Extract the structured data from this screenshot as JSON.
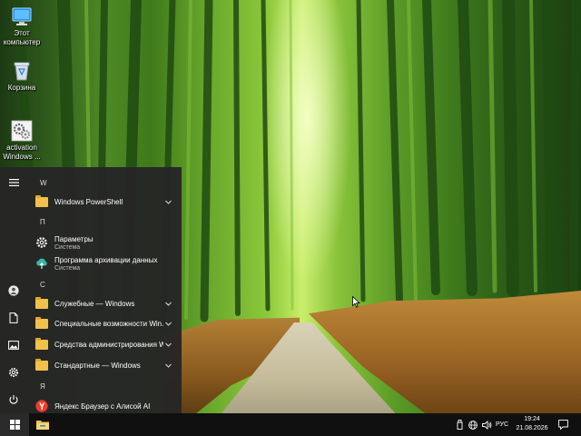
{
  "desktop": {
    "icons": [
      {
        "name": "this-pc",
        "label": "Этот компьютер",
        "icon": "monitor-icon"
      },
      {
        "name": "recycle-bin",
        "label": "Корзина",
        "icon": "recycle-bin-icon"
      },
      {
        "name": "activation-windows",
        "label": "activation Windows ...",
        "icon": "gears-icon"
      }
    ]
  },
  "start_menu": {
    "rail": [
      {
        "name": "hamburger-icon"
      },
      {
        "name": "user-avatar-icon"
      },
      {
        "name": "documents-icon"
      },
      {
        "name": "pictures-icon"
      },
      {
        "name": "settings-gear-icon"
      },
      {
        "name": "power-icon"
      }
    ],
    "groups": [
      {
        "letter": "W",
        "items": [
          {
            "label": "Windows PowerShell",
            "icon": "folder-icon",
            "expandable": true
          }
        ]
      },
      {
        "letter": "П",
        "items": [
          {
            "label": "Параметры",
            "sub": "Система",
            "icon": "settings-gear-icon"
          },
          {
            "label": "Программа архивации данных",
            "sub": "Система",
            "icon": "backup-icon"
          }
        ]
      },
      {
        "letter": "С",
        "items": [
          {
            "label": "Служебные — Windows",
            "icon": "folder-icon",
            "expandable": true
          },
          {
            "label": "Специальные возможности Win...",
            "icon": "folder-icon",
            "expandable": true
          },
          {
            "label": "Средства администрирования W...",
            "icon": "folder-icon",
            "expandable": true
          },
          {
            "label": "Стандартные — Windows",
            "icon": "folder-icon",
            "expandable": true
          }
        ]
      },
      {
        "letter": "Я",
        "items": [
          {
            "label": "Яндекс Браузер с Алисой AI",
            "icon": "yandex-browser-icon"
          }
        ]
      }
    ]
  },
  "taskbar": {
    "start_icon": "windows-logo-icon",
    "pinned": [
      {
        "name": "file-explorer-icon"
      }
    ],
    "tray": {
      "language": "РУС",
      "time": "19:24",
      "date": "21.08.2026"
    }
  },
  "colors": {
    "menu_bg": "#262626",
    "taskbar_bg": "#101010",
    "folder": "#f2c14a",
    "yandex": "#f33a2a",
    "backup": "#35b6a2"
  }
}
